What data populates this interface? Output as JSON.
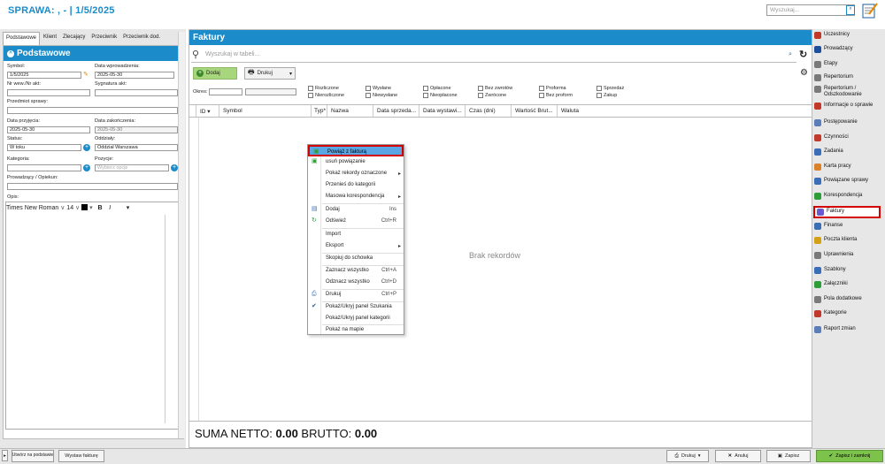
{
  "app": {
    "title": "SPRAWA: , -  | 1/5/2025",
    "search_placeholder": "Wyszukaj...",
    "search_btn": "⌕"
  },
  "left": {
    "tabs": [
      "Podstawowe",
      "Klient",
      "Zlecający",
      "Przeciwnik",
      "Przeciwnik dod."
    ],
    "header": "Podstawowe",
    "fields": {
      "symbol_label": "Symbol:",
      "symbol_value": "1/5/2025",
      "data_wprowadzenia_label": "Data wprowadzenia:",
      "data_wprowadzenia_value": "2025-05-30",
      "nr_wew_label": "Nr wew./Nr akt:",
      "sygnatura_label": "Sygnatura akt:",
      "przedmiot_label": "Przedmiot sprawy:",
      "data_przyjecia_label": "Data przyjęcia:",
      "data_przyjecia_value": "2025-05-30",
      "data_zakonczenia_label": "Data zakończenia:",
      "data_zakonczenia_value": "2025-05-30",
      "status_label": "Status:",
      "status_value": "W toku",
      "oddzialy_label": "Oddziały:",
      "oddzialy_value": "Oddział Warszawa",
      "kategoria_label": "Kategoria:",
      "pozycje_label": "Pozycje:",
      "pozycje_placeholder": "Wybierz opcje",
      "prowadzacy_label": "Prowadzący / Opiekun:",
      "opis_label": "Opis:"
    },
    "editor": {
      "font": "Times New Roman",
      "size": "14",
      "bold": "B",
      "italic": "I"
    }
  },
  "main": {
    "title": "Faktury",
    "search_placeholder": "Wyszukaj w tabeli...",
    "add_label": "Dodaj",
    "print_label": "Drukuj",
    "okres_label": "Okres:",
    "filters": [
      [
        "Rozliczone",
        "Nierozliczone"
      ],
      [
        "Wysłane",
        "Niewysłane"
      ],
      [
        "Opłacone",
        "Nieopłacone"
      ],
      [
        "Bez zwrotów",
        "Zwrócone"
      ],
      [
        "Proforma",
        "Bez proform"
      ],
      [
        "Sprzedaż",
        "Zakup"
      ]
    ],
    "columns": [
      "ID",
      "Symbol",
      "Typ*",
      "Nazwa",
      "Data sprzeda...",
      "Data wystawi...",
      "Czas (dni)",
      "Wartość Brut...",
      "Waluta"
    ],
    "empty_text": "Brak rekordów",
    "suma_prefix": "SUMA NETTO: ",
    "suma_netto": "0.00",
    "brutto_prefix": "  BRUTTO: ",
    "suma_brutto": "0.00"
  },
  "context_menu": [
    {
      "label": "Powiąż z fakturą",
      "shortcut": "",
      "arrow": false
    },
    {
      "label": "usuń powiązanie",
      "shortcut": "",
      "arrow": false
    },
    {
      "label": "Pokaż rekordy oznaczone",
      "shortcut": "",
      "arrow": true
    },
    {
      "label": "Przenieś do kategorii",
      "shortcut": "",
      "arrow": false
    },
    {
      "label": "Masowa korespondencja",
      "shortcut": "",
      "arrow": true
    },
    {
      "label": "Dodaj",
      "shortcut": "Ins",
      "arrow": false
    },
    {
      "label": "Odśwież",
      "shortcut": "Ctrl+R",
      "arrow": false
    },
    {
      "label": "Import",
      "shortcut": "",
      "arrow": false
    },
    {
      "label": "Eksport",
      "shortcut": "",
      "arrow": true
    },
    {
      "label": "Skopiuj do schowka",
      "shortcut": "",
      "arrow": false
    },
    {
      "label": "Zaznacz wszystko",
      "shortcut": "Ctrl+A",
      "arrow": false
    },
    {
      "label": "Odznacz wszystko",
      "shortcut": "Ctrl+D",
      "arrow": false
    },
    {
      "label": "Drukuj",
      "shortcut": "Ctrl+P",
      "arrow": false
    },
    {
      "label": "Pokaż/Ukryj panel Szukania",
      "shortcut": "",
      "arrow": false
    },
    {
      "label": "Pokaż/Ukryj panel kategorii",
      "shortcut": "",
      "arrow": false
    },
    {
      "label": "Pokaż na mapie",
      "shortcut": "",
      "arrow": false
    }
  ],
  "right_menu": [
    {
      "label": "Uczestnicy",
      "color": "#c0392b"
    },
    {
      "label": "Prowadzący",
      "color": "#1f4e9c"
    },
    {
      "label": "Etapy",
      "color": "#7a7a7a"
    },
    {
      "label": "Repertorium",
      "color": "#7a7a7a"
    },
    {
      "label": "Repertorium / Odszkodowanie",
      "color": "#7a7a7a"
    },
    {
      "label": "Informacje o sprawie",
      "color": "#c0392b"
    },
    {
      "label": "Postępowanie",
      "color": "#5a7fb8"
    },
    {
      "label": "Czynności",
      "color": "#c0392b"
    },
    {
      "label": "Zadania",
      "color": "#3a6fb8"
    },
    {
      "label": "Karta pracy",
      "color": "#d9822b"
    },
    {
      "label": "Powiązane sprawy",
      "color": "#3a6fb8"
    },
    {
      "label": "Korespondencja",
      "color": "#2e9e3a"
    },
    {
      "label": "Faktury",
      "color": "#6a5acd"
    },
    {
      "label": "Finanse",
      "color": "#3a6fb8"
    },
    {
      "label": "Poczta klienta",
      "color": "#d4a017"
    },
    {
      "label": "Uprawnienia",
      "color": "#7a7a7a"
    },
    {
      "label": "Szablony",
      "color": "#3a6fb8"
    },
    {
      "label": "Załączniki",
      "color": "#2e9e3a"
    },
    {
      "label": "Pola dodatkowe",
      "color": "#7a7a7a"
    },
    {
      "label": "Kategorie",
      "color": "#c0392b"
    },
    {
      "label": "Raport zmian",
      "color": "#5a7fb8"
    }
  ],
  "bottom": {
    "create_label": "Utwórz na podstawie",
    "invoice_label": "Wystaw fakturę",
    "print_label": "Drukuj",
    "cancel_label": "Anuluj",
    "save_label": "Zapisz",
    "save_close_label": "Zapisz i zamknij"
  }
}
